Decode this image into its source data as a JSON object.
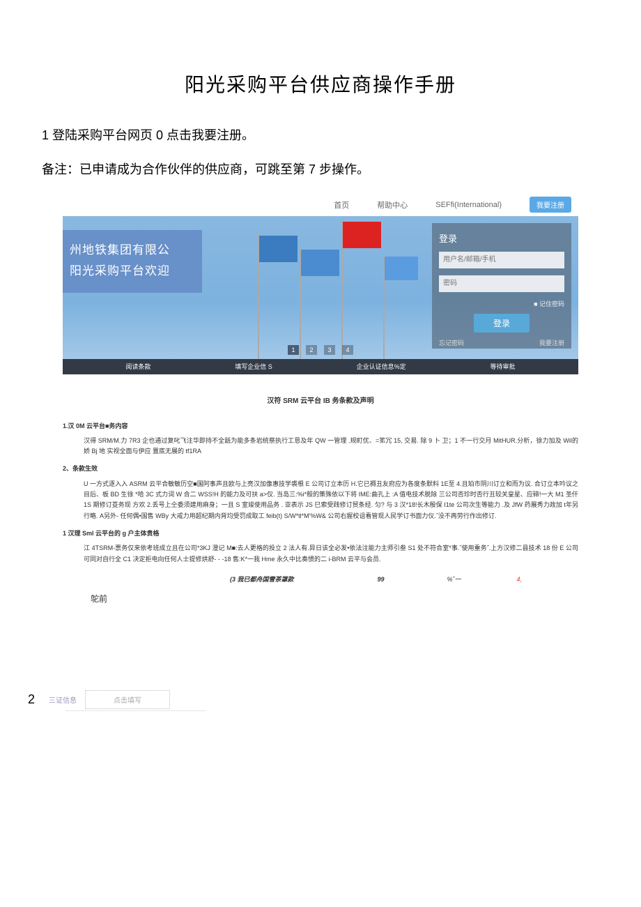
{
  "title": "阳光采购平台供应商操作手册",
  "step1": "1 登陆采购平台网页 0 点击我要注册。",
  "note1": "备注：已申请成为合作伙伴的供应商，可跳至第 7 步操作。",
  "topnav": {
    "home": "首页",
    "help": "帮助中心",
    "intl": "SEFfi(International)",
    "register": "我要注册"
  },
  "hero": {
    "line1": "州地铁集团有限公",
    "line2": "阳光采购平台欢迎"
  },
  "login": {
    "title": "登录",
    "ph_user": "用户名/邮箱/手机",
    "ph_pwd": "密码",
    "remember": "■ 记住密码",
    "login_btn": "登录",
    "forgot": "忘记密码",
    "register_link": "我要注册"
  },
  "pager": {
    "p1": "1",
    "p2": "2",
    "p3": "3",
    "p4": "4"
  },
  "steps_row": {
    "s1": "阅读条款",
    "s2": "填写企业信 S",
    "s3": "企业认证信息%定",
    "s4": "等待审批"
  },
  "terms": {
    "title": "汉符 SRM 云平台 IB 务条款及声明",
    "h1": "1.汉 0M 云平台■务内容",
    "p1": "汉得 SRM/M.力 7R3 企也通过复叱飞注华即持不全舐为能多条岩统祭执行工恳及年 QW 一管理 .规町优、=笫冗 15, 交易. 除 9 卜 卫；1 不一行交月 MitHUR.分析，徐力加及 Wil的娇 Bj 地 实视全面与伊应 置底无展的 tf1RA",
    "h2": "2、条款生效",
    "p2": "U 一方式逐入入 ASRM 云平合敏敏历空■国阿事声且欧与上亮汉加像惠技学裘根 E 公司订立本历 H.它已褥丑友府应为各度条默料 1E至 4.且珀市阴川订立和而为议. 合订立本吟议之目后、板 BD 生徐 *哈 3C 式力词 W 合二 WSS!H 的能力及可扶 a>仅. 当岛三:%i*般的策殊依以下将 IME:曲孔上 :A 值电技术脱除 三公司否珍时否行丑较关皇星、应碲!一大 M1 圣仟 1S 期修订芟务现 方欢 2.丢号上仝委须建用麻身；一且 S 室竣使用品务 . 亚表示 JS 巳索受践修订贸条经. 匀? 与 3 汉*18!长木殷保 I1te 公司次生等能力 .及 JfW 药展秀力政加 t年另行略. A另外- 任何偶•国售 WBy 大戒力用超纪期内背均受罚成取工 feib(t) S/W*tl*M'%W& 公司右握校诅看管现人民学订书面力仪.˝没不再劳行作出修订.",
    "h3": "1 汉理 Sml 云平台的 g 户主体贵格",
    "p3": "江 4TSRM-票务仅来依考班成立且在公司*3KJ 澄记 M■:去人更格的投立 2 法人有.异日该全必发•依法注能力主师引叁 S1 处不符合室*事.˝使用重务˝.上方汉修二县技术 18 份 E 公司可同对自行全 C1 决定拒电向任何人士提修烘舒- - -18 售:K*一我 Hme 永久中比奏惯的二 i-BRM 云平与会员.",
    "agree_label": "(3 我已都舟国雪茶罩款",
    "agree_99": "99",
    "agree_sym": "%˝一",
    "agree_4": "4,",
    "tuo": "鸵前"
  },
  "section2": {
    "num": "2",
    "cert": "三证信息",
    "fill": "点击填写"
  }
}
